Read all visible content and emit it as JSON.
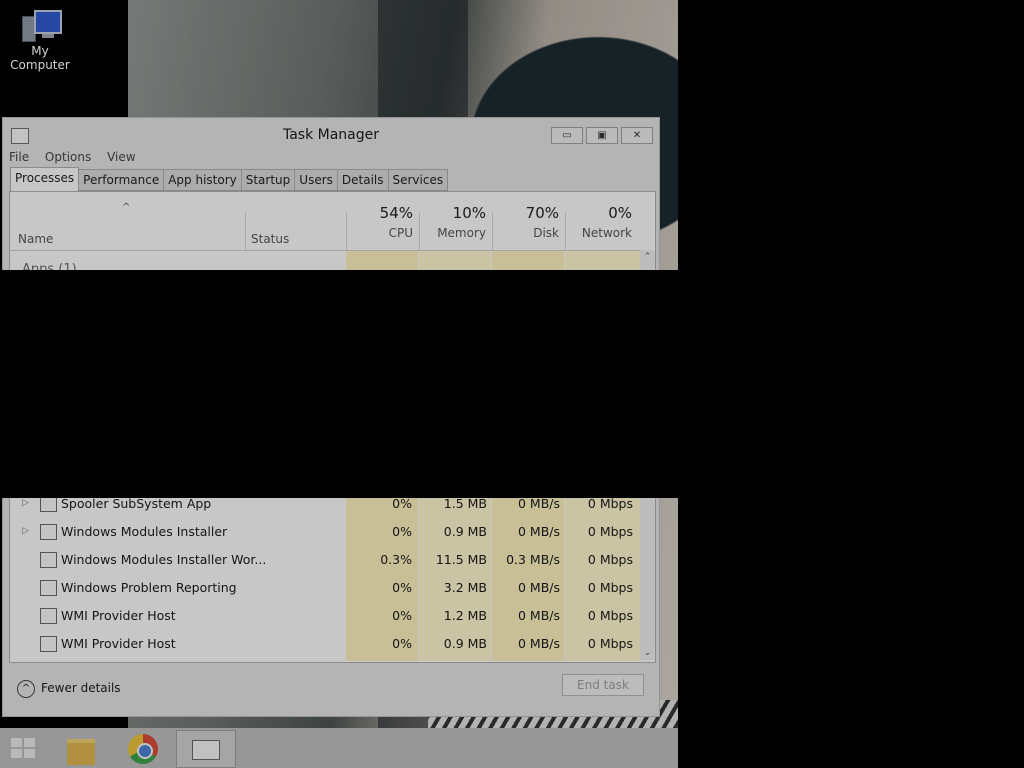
{
  "desktop": {
    "icons": [
      {
        "label": "My Computer",
        "icon": "computer-icon"
      }
    ]
  },
  "window": {
    "title": "Task Manager",
    "menu": [
      "File",
      "Options",
      "View"
    ],
    "tabs": [
      "Processes",
      "Performance",
      "App history",
      "Startup",
      "Users",
      "Details",
      "Services"
    ],
    "active_tab": "Processes",
    "columns": {
      "name": "Name",
      "status": "Status",
      "cpu": {
        "pct": "54%",
        "label": "CPU"
      },
      "memory": {
        "pct": "10%",
        "label": "Memory"
      },
      "disk": {
        "pct": "70%",
        "label": "Disk"
      },
      "network": {
        "pct": "0%",
        "label": "Network"
      }
    },
    "group_label": "Apps (1)",
    "processes": [
      {
        "name": "Spooler SubSystem App",
        "expandable": true,
        "icon": "printer-icon",
        "cpu": "0%",
        "memory": "1.5 MB",
        "disk": "0 MB/s",
        "network": "0 Mbps"
      },
      {
        "name": "Windows Modules Installer",
        "expandable": true,
        "icon": "installer-icon",
        "cpu": "0%",
        "memory": "0.9 MB",
        "disk": "0 MB/s",
        "network": "0 Mbps"
      },
      {
        "name": "Windows Modules Installer Wor...",
        "expandable": false,
        "icon": "installer-icon",
        "cpu": "0.3%",
        "memory": "11.5 MB",
        "disk": "0.3 MB/s",
        "network": "0 Mbps"
      },
      {
        "name": "Windows Problem Reporting",
        "expandable": false,
        "icon": "problem-reporting-icon",
        "cpu": "0%",
        "memory": "3.2 MB",
        "disk": "0 MB/s",
        "network": "0 Mbps"
      },
      {
        "name": "WMI Provider Host",
        "expandable": false,
        "icon": "wmi-icon",
        "cpu": "0%",
        "memory": "1.2 MB",
        "disk": "0 MB/s",
        "network": "0 Mbps"
      },
      {
        "name": "WMI Provider Host",
        "expandable": false,
        "icon": "wmi-icon",
        "cpu": "0%",
        "memory": "0.9 MB",
        "disk": "0 MB/s",
        "network": "0 Mbps"
      }
    ],
    "footer": {
      "fewer_details": "Fewer details",
      "end_task": "End task"
    }
  },
  "taskbar": {
    "items": [
      {
        "icon": "windows-start-icon"
      },
      {
        "icon": "file-explorer-icon"
      },
      {
        "icon": "chrome-icon"
      },
      {
        "icon": "task-manager-icon"
      }
    ]
  }
}
